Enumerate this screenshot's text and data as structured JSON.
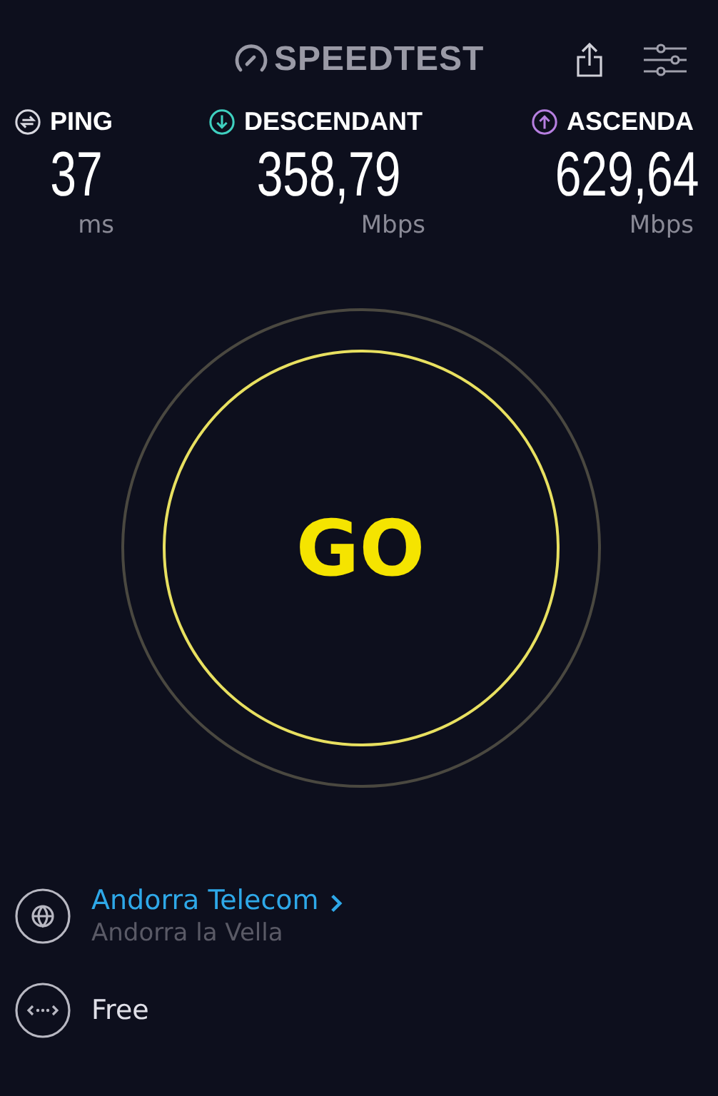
{
  "header": {
    "logo": "SPEEDTEST"
  },
  "metrics": [
    {
      "kind": "ping",
      "label": "PING",
      "value": "37",
      "unit": "ms",
      "color": "#d8d8e0"
    },
    {
      "kind": "download",
      "label": "DESCENDANT",
      "value": "358,79",
      "unit": "Mbps",
      "color": "#3fd0c0"
    },
    {
      "kind": "upload",
      "label": "ASCENDA",
      "value": "629,64",
      "unit": "Mbps",
      "color": "#b67fe0"
    }
  ],
  "go_button": {
    "label": "GO"
  },
  "server": {
    "provider": "Andorra Telecom",
    "location": "Andorra la Vella"
  },
  "connection": {
    "name": "Free"
  }
}
